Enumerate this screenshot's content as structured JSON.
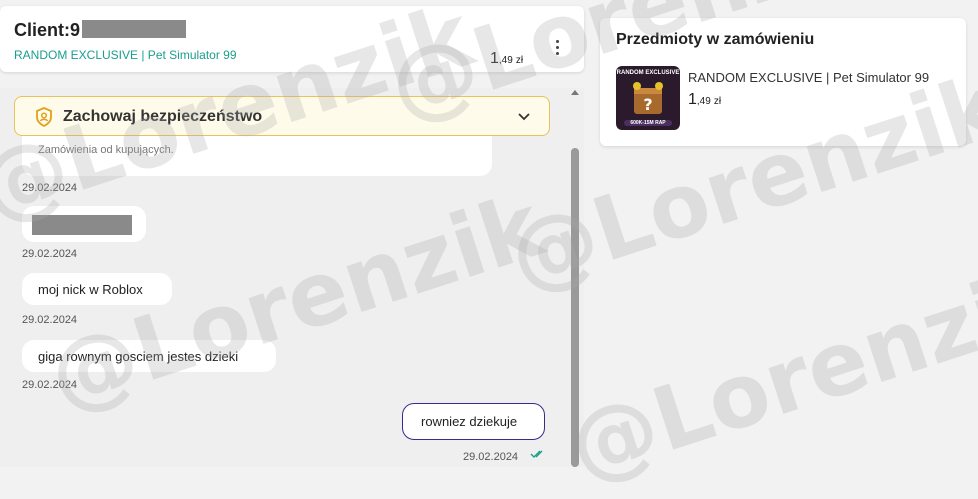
{
  "client": {
    "title": "Client:9",
    "product": "RANDOM EXCLUSIVE | Pet Simulator 99",
    "price_big": "1",
    "price_small": ",49",
    "currency": "zł"
  },
  "security": {
    "title": "Zachowaj bezpieczeństwo"
  },
  "messages": [
    {
      "text": "Zamówienia od kupujących.",
      "date": "29.02.2024"
    },
    {
      "text": "",
      "date": "29.02.2024"
    },
    {
      "text": "moj nick w Roblox",
      "date": "29.02.2024"
    },
    {
      "text": "giga rownym gosciem jestes dzieki",
      "date": "29.02.2024"
    },
    {
      "text": "rowniez dziekuje",
      "date": "29.02.2024"
    }
  ],
  "order": {
    "title": "Przedmioty w zamówieniu",
    "item_name": "RANDOM EXCLUSIVE | Pet Simulator 99",
    "price_big": "1",
    "price_small": ",49",
    "currency": "zł",
    "thumb_top": "RANDOM EXCLUSIVE",
    "thumb_bottom": "600K-15M RAP"
  },
  "watermark": "@Lorenzik",
  "colors": {
    "accent_teal": "#1a9e8c",
    "warning_border": "#e8c25a",
    "sent_border": "#3b2a8a",
    "read_check": "#1a9e8c"
  },
  "icons": [
    "shield-user-icon",
    "chevron-down-icon",
    "kebab-menu-icon",
    "double-check-icon",
    "scroll-up-icon"
  ]
}
